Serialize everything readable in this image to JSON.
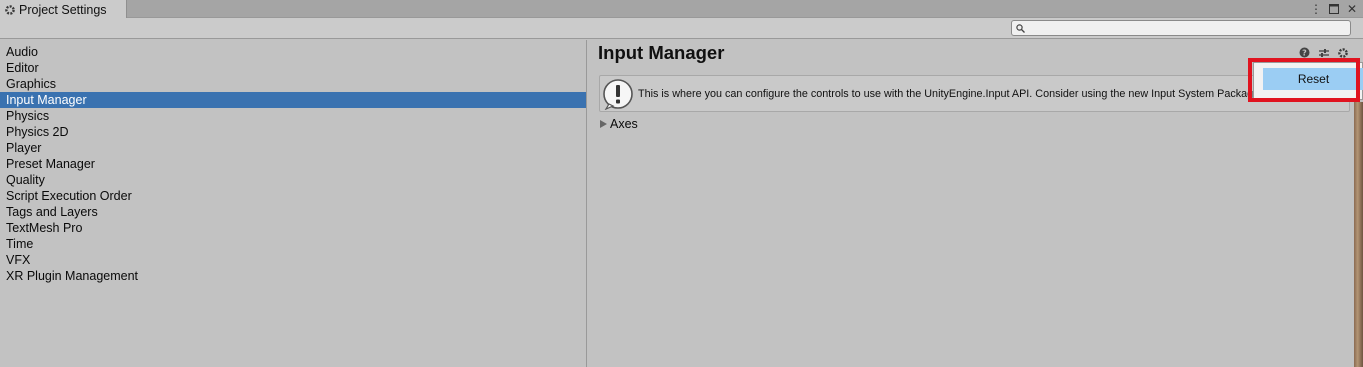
{
  "window": {
    "tab_title": "Project Settings",
    "controls": [
      "more-icon",
      "maximize-icon",
      "close-icon"
    ]
  },
  "search": {
    "placeholder": "",
    "value": ""
  },
  "sidebar": {
    "items": [
      {
        "label": "Audio",
        "selected": false
      },
      {
        "label": "Editor",
        "selected": false
      },
      {
        "label": "Graphics",
        "selected": false
      },
      {
        "label": "Input Manager",
        "selected": true
      },
      {
        "label": "Physics",
        "selected": false
      },
      {
        "label": "Physics 2D",
        "selected": false
      },
      {
        "label": "Player",
        "selected": false
      },
      {
        "label": "Preset Manager",
        "selected": false
      },
      {
        "label": "Quality",
        "selected": false
      },
      {
        "label": "Script Execution Order",
        "selected": false
      },
      {
        "label": "Tags and Layers",
        "selected": false
      },
      {
        "label": "TextMesh Pro",
        "selected": false
      },
      {
        "label": "Time",
        "selected": false
      },
      {
        "label": "VFX",
        "selected": false
      },
      {
        "label": "XR Plugin Management",
        "selected": false
      }
    ]
  },
  "main": {
    "title": "Input Manager",
    "help_text": "This is where you can configure the controls to use with the UnityEngine.Input API. Consider using the new Input System Package instead.",
    "foldout_label": "Axes"
  },
  "context_menu": {
    "items": [
      {
        "label": "Reset"
      }
    ]
  },
  "colors": {
    "selection": "#3a72b0",
    "menu_hover": "#9bcdf3",
    "highlight_border": "#e0131f"
  }
}
